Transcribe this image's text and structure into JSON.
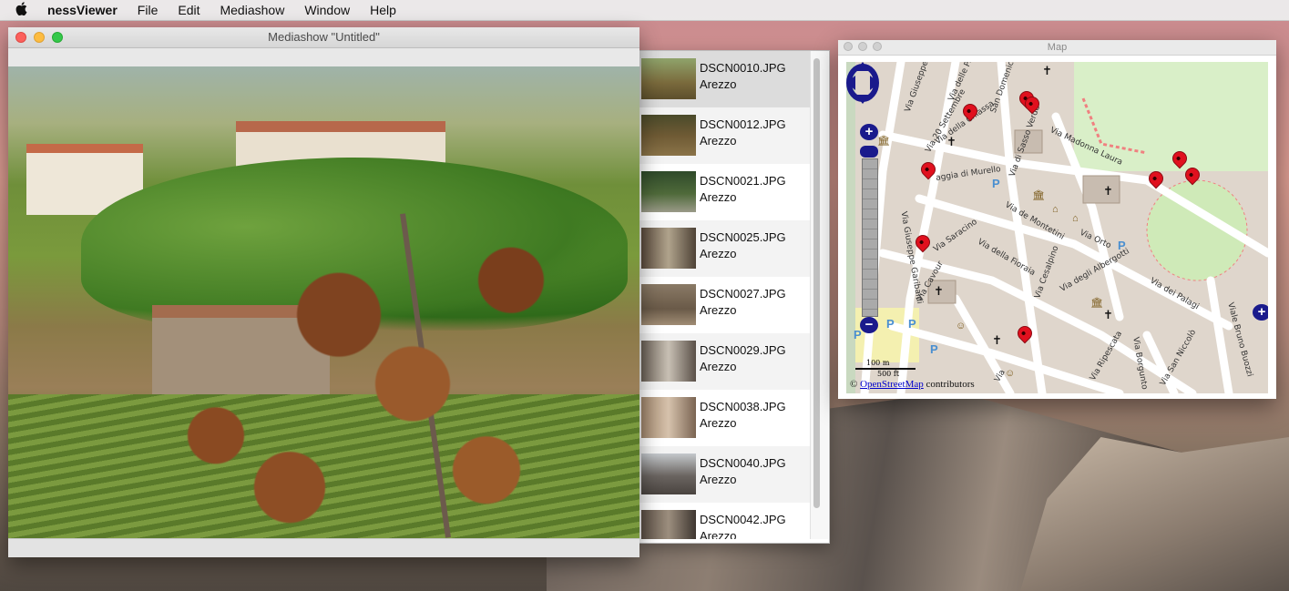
{
  "menubar": {
    "apple": "",
    "items": [
      "nessViewer",
      "File",
      "Edit",
      "Mediashow",
      "Window",
      "Help"
    ]
  },
  "mediashow": {
    "title": "Mediashow \"Untitled\""
  },
  "thumbnails": [
    {
      "file": "DSCN0010.JPG",
      "place": "Arezzo",
      "selected": true
    },
    {
      "file": "DSCN0012.JPG",
      "place": "Arezzo"
    },
    {
      "file": "DSCN0021.JPG",
      "place": "Arezzo"
    },
    {
      "file": "DSCN0025.JPG",
      "place": "Arezzo"
    },
    {
      "file": "DSCN0027.JPG",
      "place": "Arezzo"
    },
    {
      "file": "DSCN0029.JPG",
      "place": "Arezzo"
    },
    {
      "file": "DSCN0038.JPG",
      "place": "Arezzo"
    },
    {
      "file": "DSCN0040.JPG",
      "place": "Arezzo"
    },
    {
      "file": "DSCN0042.JPG",
      "place": "Arezzo"
    }
  ],
  "map": {
    "title": "Map",
    "streets": [
      "Via Giuseppe",
      "Via delle Pa",
      "San Domenico",
      "Via 20 Settembre",
      "Via della Chiassa",
      "Via di Sasso Verde",
      "Via Madonna Laura",
      "aggia di Murello",
      "Via de Montetini",
      "Via Orto",
      "Via Saracino",
      "Via della Fioraia",
      "Via Cesalpino",
      "Via degli Albergotti",
      "Via dei Palagi",
      "Via Giuseppe Garibaldi",
      "Via Cavour",
      "Via Ripescata",
      "Via Borgunto",
      "Via San Niccolò",
      "Viale Bruno Buozzi",
      "Via"
    ],
    "scale_top": "100 m",
    "scale_bottom": "500 ft",
    "attribution_prefix": "©",
    "attribution_link": "OpenStreetMap",
    "attribution_suffix": "contributors",
    "zoom_in": "+",
    "zoom_out": "−",
    "side_button": "+",
    "parking": "P"
  },
  "colors": {
    "pin": "#e0101e",
    "zoom_control": "#1a1a8c",
    "close": "#fc605c",
    "minimize": "#fdbc40",
    "maximize": "#34c84a"
  }
}
